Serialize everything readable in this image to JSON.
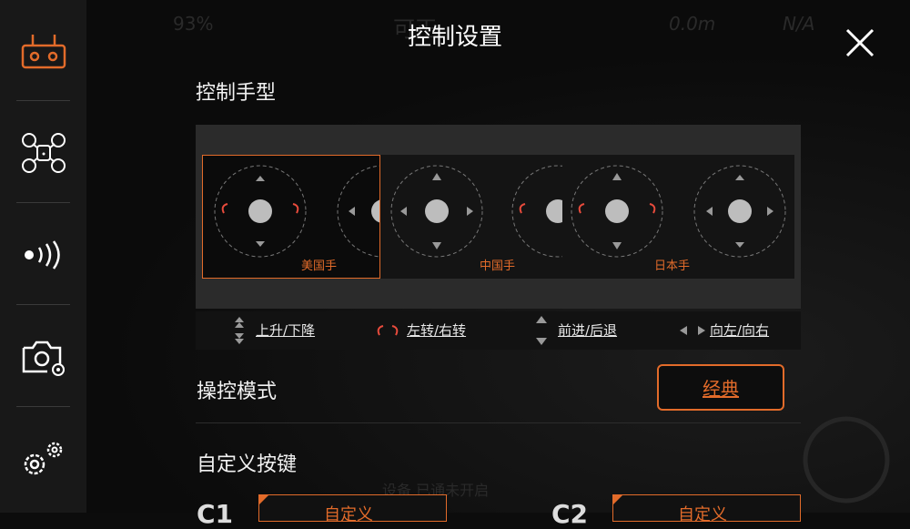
{
  "header": {
    "title": "控制设置"
  },
  "background": {
    "battery": "93%",
    "altitude": "0.0m",
    "gps": "N/A",
    "center_text": "可正",
    "bottom_text": "设备 已通未开启"
  },
  "sidebar": {
    "items": [
      {
        "icon": "remote-controller-icon"
      },
      {
        "icon": "drone-icon"
      },
      {
        "icon": "signal-icon"
      },
      {
        "icon": "camera-settings-icon"
      },
      {
        "icon": "gear-icon"
      }
    ]
  },
  "stick_mode": {
    "title": "控制手型",
    "options": [
      {
        "label": "美国手",
        "selected": true
      },
      {
        "label": "中国手",
        "selected": false
      },
      {
        "label": "日本手",
        "selected": false
      }
    ],
    "legend": [
      {
        "label": "上升/下降"
      },
      {
        "label": "左转/右转"
      },
      {
        "label": "前进/后退"
      },
      {
        "label": "向左/向右"
      }
    ]
  },
  "control_mode": {
    "title": "操控模式",
    "value": "经典"
  },
  "custom_keys": {
    "title": "自定义按键",
    "c1_label": "C1",
    "c2_label": "C2",
    "c1_value": "自定义",
    "c2_value": "自定义"
  },
  "colors": {
    "accent": "#e26b2a",
    "panel": "#2b2b2b",
    "sidebar": "#181818"
  }
}
